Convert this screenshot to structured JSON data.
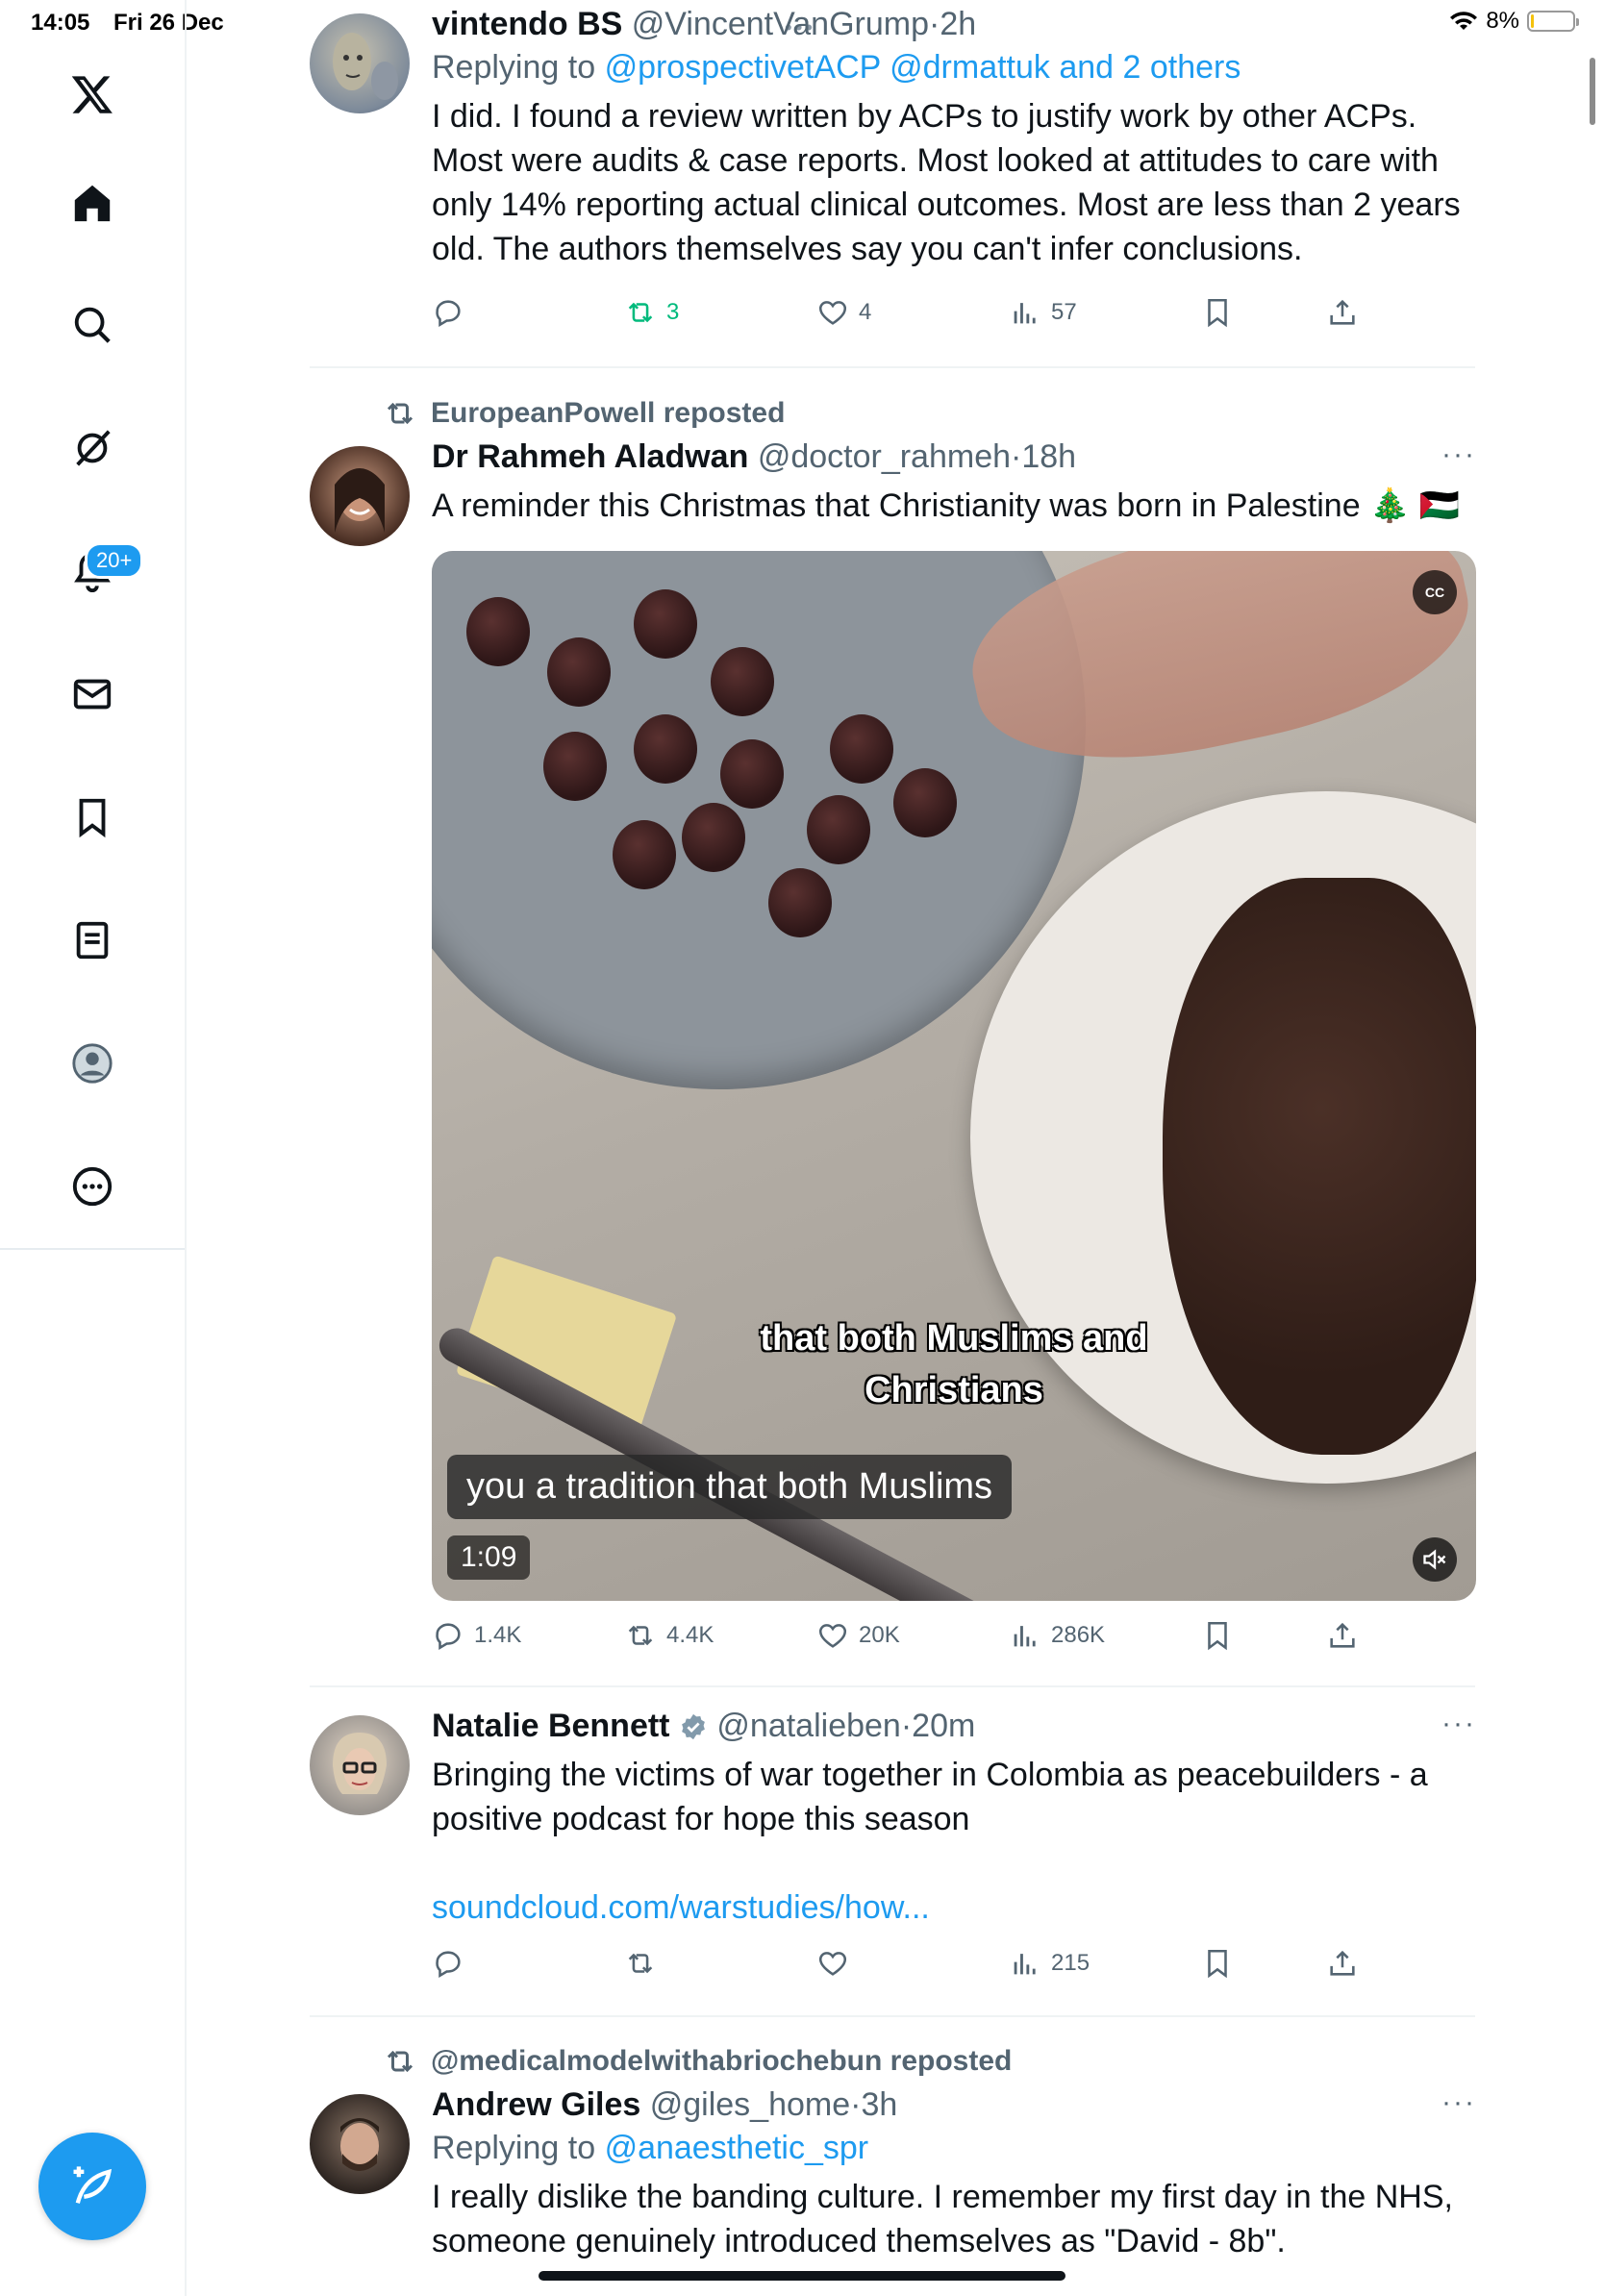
{
  "status_bar": {
    "time": "14:05",
    "date": "Fri 26 Dec",
    "battery": "8%",
    "battery_level": 0.08
  },
  "sidebar": {
    "logo": "x-logo-icon",
    "items": [
      {
        "name": "home",
        "icon": "home-icon"
      },
      {
        "name": "explore",
        "icon": "search-icon"
      },
      {
        "name": "grok",
        "icon": "grok-icon"
      },
      {
        "name": "notifications",
        "icon": "bell-icon",
        "badge": "20+"
      },
      {
        "name": "messages",
        "icon": "envelope-icon"
      },
      {
        "name": "bookmarks",
        "icon": "bookmark-icon"
      },
      {
        "name": "lists",
        "icon": "list-icon"
      },
      {
        "name": "profile",
        "icon": "profile-icon"
      },
      {
        "name": "more",
        "icon": "more-circle-icon"
      }
    ],
    "compose_icon": "compose-icon"
  },
  "posts": [
    {
      "name": "vintendo BS",
      "handle": "@VincentVanGrump",
      "sep": "·",
      "time": "2h",
      "reply_prefix": "Replying to",
      "reply_to": "@prospectivetACP @drmattuk and 2 others",
      "text": "I did. I found a review written by ACPs to justify work by other ACPs. Most were audits & case reports. Most looked at attitudes to care with only 14% reporting actual clinical outcomes. Most are less than 2 years old. The authors themselves say you can't infer conclusions.",
      "replies": "",
      "reposts": "3",
      "likes": "4",
      "views": "57"
    },
    {
      "repost_by": "EuropeanPowell reposted",
      "name": "Dr Rahmeh Aladwan",
      "handle": "@doctor_rahmeh",
      "sep": "·",
      "time": "18h",
      "more": "···",
      "text": "A reminder this Christmas that Christianity was born in Palestine 🎄 🇵🇸",
      "media": {
        "caption_burned": "that both Muslims and\nChristians",
        "caption_line1": "that both Muslims and",
        "caption_line2": "Christians",
        "subtitle": "you a tradition that both Muslims",
        "duration": "1:09",
        "cc": "CC"
      },
      "replies": "1.4K",
      "reposts": "4.4K",
      "likes": "20K",
      "views": "286K"
    },
    {
      "name": "Natalie Bennett",
      "verified": true,
      "handle": "@natalieben",
      "sep": "·",
      "time": "20m",
      "more": "···",
      "text": "Bringing the victims of war together in Colombia as peacebuilders - a positive podcast for hope this season",
      "link": "soundcloud.com/warstudies/how...",
      "replies": "",
      "reposts": "",
      "likes": "",
      "views": "215"
    },
    {
      "repost_by": "@medicalmodelwithabriochebun reposted",
      "name": "Andrew Giles",
      "handle": "@giles_home",
      "sep": "·",
      "time": "3h",
      "more": "···",
      "reply_prefix": "Replying to",
      "reply_to": "@anaesthetic_spr",
      "text": "I really dislike the banding culture. I remember my first day in the NHS, someone genuinely introduced themselves as \"David - 8b\"."
    }
  ],
  "colors": {
    "accent": "#1d9bf0",
    "repost_active": "#00ba7c",
    "muted_text": "#536471"
  }
}
